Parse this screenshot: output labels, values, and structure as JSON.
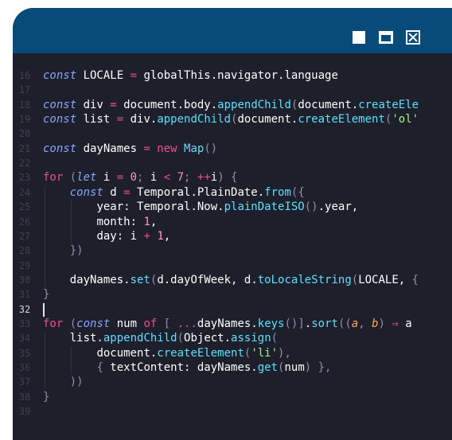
{
  "window": {
    "controls": {
      "minimize": "minimize",
      "maximize": "maximize",
      "close": "close"
    }
  },
  "editor": {
    "active_line": 32,
    "lines": [
      {
        "num": "16",
        "tokens": [
          [
            "ki",
            "const "
          ],
          [
            "v",
            "LOCALE "
          ],
          [
            "o",
            "= "
          ],
          [
            "v",
            "globalThis.navigator.language"
          ]
        ]
      },
      {
        "num": "17",
        "tokens": []
      },
      {
        "num": "18",
        "tokens": [
          [
            "ki",
            "const "
          ],
          [
            "v",
            "div "
          ],
          [
            "o",
            "= "
          ],
          [
            "v",
            "document.body."
          ],
          [
            "f",
            "appendChild"
          ],
          [
            "p",
            "("
          ],
          [
            "v",
            "document."
          ],
          [
            "f",
            "createEle"
          ]
        ]
      },
      {
        "num": "19",
        "tokens": [
          [
            "ki",
            "const "
          ],
          [
            "v",
            "list "
          ],
          [
            "o",
            "= "
          ],
          [
            "v",
            "div."
          ],
          [
            "f",
            "appendChild"
          ],
          [
            "p",
            "("
          ],
          [
            "v",
            "document."
          ],
          [
            "f",
            "createElement"
          ],
          [
            "p",
            "("
          ],
          [
            "s",
            "'ol'"
          ]
        ]
      },
      {
        "num": "20",
        "tokens": []
      },
      {
        "num": "21",
        "tokens": [
          [
            "ki",
            "const "
          ],
          [
            "v",
            "dayNames "
          ],
          [
            "o",
            "= "
          ],
          [
            "k",
            "new "
          ],
          [
            "f",
            "Map"
          ],
          [
            "p",
            "()"
          ]
        ]
      },
      {
        "num": "22",
        "tokens": []
      },
      {
        "num": "23",
        "tokens": [
          [
            "k",
            "for "
          ],
          [
            "p",
            "("
          ],
          [
            "ki",
            "let "
          ],
          [
            "v",
            "i "
          ],
          [
            "o",
            "= "
          ],
          [
            "n",
            "0"
          ],
          [
            "p",
            "; "
          ],
          [
            "v",
            "i "
          ],
          [
            "o",
            "< "
          ],
          [
            "n",
            "7"
          ],
          [
            "p",
            "; "
          ],
          [
            "o",
            "++"
          ],
          [
            "v",
            "i"
          ],
          [
            "p",
            ") {"
          ]
        ]
      },
      {
        "num": "24",
        "tokens": [
          [
            "sp",
            "    "
          ],
          [
            "ki",
            "const "
          ],
          [
            "v",
            "d "
          ],
          [
            "o",
            "= "
          ],
          [
            "v",
            "Temporal.PlainDate."
          ],
          [
            "f",
            "from"
          ],
          [
            "p",
            "({"
          ]
        ]
      },
      {
        "num": "25",
        "tokens": [
          [
            "sp",
            "        "
          ],
          [
            "v",
            "year: Temporal.Now."
          ],
          [
            "f",
            "plainDateISO"
          ],
          [
            "p",
            "()"
          ],
          [
            "v",
            ".year,"
          ]
        ]
      },
      {
        "num": "26",
        "tokens": [
          [
            "sp",
            "        "
          ],
          [
            "v",
            "month: "
          ],
          [
            "n",
            "1"
          ],
          [
            "v",
            ","
          ]
        ]
      },
      {
        "num": "27",
        "tokens": [
          [
            "sp",
            "        "
          ],
          [
            "v",
            "day: i "
          ],
          [
            "o",
            "+ "
          ],
          [
            "n",
            "1"
          ],
          [
            "v",
            ","
          ]
        ]
      },
      {
        "num": "28",
        "tokens": [
          [
            "sp",
            "    "
          ],
          [
            "p",
            "})"
          ]
        ]
      },
      {
        "num": "29",
        "tokens": []
      },
      {
        "num": "30",
        "tokens": [
          [
            "sp",
            "    "
          ],
          [
            "v",
            "dayNames."
          ],
          [
            "f",
            "set"
          ],
          [
            "p",
            "("
          ],
          [
            "v",
            "d.dayOfWeek, d."
          ],
          [
            "f",
            "toLocaleString"
          ],
          [
            "p",
            "("
          ],
          [
            "v",
            "LOCALE, "
          ],
          [
            "p",
            "{"
          ]
        ]
      },
      {
        "num": "31",
        "tokens": [
          [
            "p",
            "}"
          ]
        ]
      },
      {
        "num": "32",
        "tokens": []
      },
      {
        "num": "33",
        "tokens": [
          [
            "k",
            "for "
          ],
          [
            "p",
            "("
          ],
          [
            "ki",
            "const "
          ],
          [
            "v",
            "num "
          ],
          [
            "k",
            "of "
          ],
          [
            "p",
            "[ "
          ],
          [
            "o",
            "..."
          ],
          [
            "v",
            "dayNames."
          ],
          [
            "f",
            "keys"
          ],
          [
            "p",
            "()]"
          ],
          [
            "v",
            "."
          ],
          [
            "f",
            "sort"
          ],
          [
            "p",
            "(("
          ],
          [
            "pa",
            "a"
          ],
          [
            "p",
            ", "
          ],
          [
            "pa",
            "b"
          ],
          [
            "p",
            ") "
          ],
          [
            "o",
            "⇒ "
          ],
          [
            "v",
            "a"
          ]
        ]
      },
      {
        "num": "34",
        "tokens": [
          [
            "sp",
            "    "
          ],
          [
            "v",
            "list."
          ],
          [
            "f",
            "appendChild"
          ],
          [
            "p",
            "("
          ],
          [
            "v",
            "Object."
          ],
          [
            "f",
            "assign"
          ],
          [
            "p",
            "("
          ]
        ]
      },
      {
        "num": "35",
        "tokens": [
          [
            "sp",
            "        "
          ],
          [
            "v",
            "document."
          ],
          [
            "f",
            "createElement"
          ],
          [
            "p",
            "("
          ],
          [
            "s",
            "'li'"
          ],
          [
            "p",
            "),"
          ]
        ]
      },
      {
        "num": "36",
        "tokens": [
          [
            "sp",
            "        "
          ],
          [
            "p",
            "{ "
          ],
          [
            "v",
            "textContent: dayNames."
          ],
          [
            "f",
            "get"
          ],
          [
            "p",
            "("
          ],
          [
            "v",
            "num"
          ],
          [
            "p",
            ") },"
          ]
        ]
      },
      {
        "num": "37",
        "tokens": [
          [
            "sp",
            "    "
          ],
          [
            "p",
            "))"
          ]
        ]
      },
      {
        "num": "38",
        "tokens": [
          [
            "p",
            "}"
          ]
        ]
      },
      {
        "num": "39",
        "tokens": []
      }
    ]
  }
}
